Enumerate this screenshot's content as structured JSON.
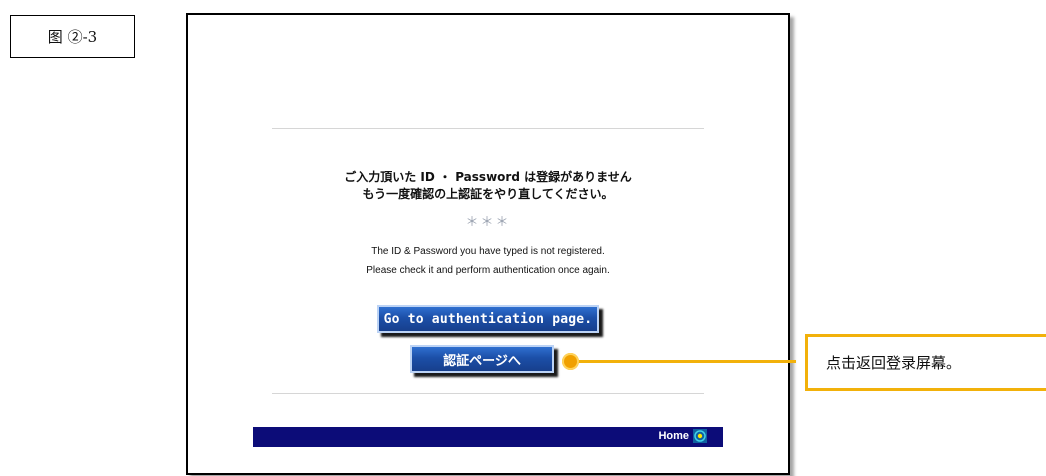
{
  "figure_label": "图 ②-3",
  "page": {
    "message_jp_line1": "ご入力頂いた ID ・ Password は登録がありません",
    "message_jp_line2": "もう一度確認の上認証をやり直してください。",
    "separator": "＊＊＊",
    "message_en_line1": "The ID & Password you have typed is not registered.",
    "message_en_line2": "Please check it and perform authentication once again.",
    "button_en": "Go to authentication page.",
    "button_jp": "認証ページへ",
    "home_label": "Home"
  },
  "callout": {
    "text": "点击返回登录屏幕。",
    "color": "#f2b10a"
  },
  "colors": {
    "button_blue": "#1c4fa8",
    "footer_navy": "#0c0c78"
  },
  "icons": {
    "home": "home-target-icon",
    "callout_marker": "callout-dot-icon"
  }
}
